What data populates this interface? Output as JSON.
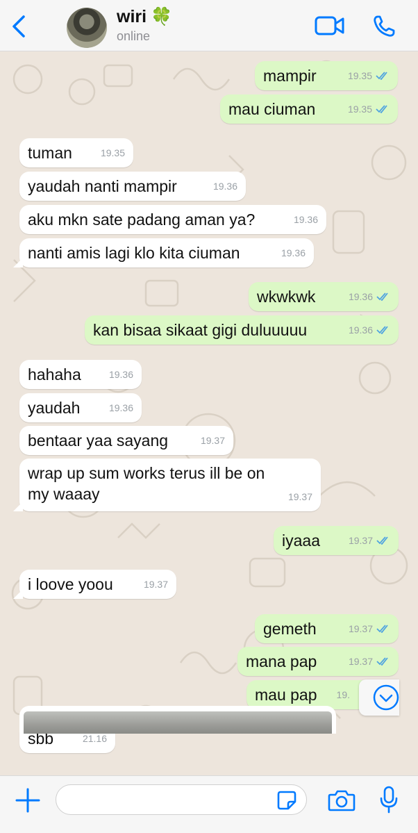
{
  "header": {
    "contact_name": "wiri",
    "name_emoji": "🍀",
    "status": "online",
    "icons": {
      "back": "chevron-left-icon",
      "video": "video-camera-icon",
      "call": "phone-icon"
    },
    "accent_color": "#007aff"
  },
  "messages": [
    {
      "dir": "out",
      "text": "mampir",
      "time": "19.35",
      "read": true
    },
    {
      "dir": "out",
      "text": "mau ciuman",
      "time": "19.35",
      "read": true
    },
    {
      "dir": "in",
      "text": "tuman",
      "time": "19.35"
    },
    {
      "dir": "in",
      "text": "yaudah nanti mampir",
      "time": "19.36"
    },
    {
      "dir": "in",
      "text": "aku mkn sate padang aman ya?",
      "time": "19.36"
    },
    {
      "dir": "in",
      "text": "nanti amis lagi klo kita ciuman",
      "time": "19.36"
    },
    {
      "dir": "out",
      "text": "wkwkwk",
      "time": "19.36",
      "read": true
    },
    {
      "dir": "out",
      "text": "kan bisaa sikaat gigi duluuuuu",
      "time": "19.36",
      "read": true
    },
    {
      "dir": "in",
      "text": "hahaha",
      "time": "19.36"
    },
    {
      "dir": "in",
      "text": "yaudah",
      "time": "19.36"
    },
    {
      "dir": "in",
      "text": "bentaar yaa sayang",
      "time": "19.37"
    },
    {
      "dir": "in",
      "text": "wrap up sum works terus ill be on my waaay",
      "time": "19.37"
    },
    {
      "dir": "out",
      "text": "iyaaa",
      "time": "19.37",
      "read": true
    },
    {
      "dir": "in",
      "text": "i loove yoou",
      "time": "19.37"
    },
    {
      "dir": "out",
      "text": "gemeth",
      "time": "19.37",
      "read": true
    },
    {
      "dir": "out",
      "text": "mana pap",
      "time": "19.37",
      "read": true
    },
    {
      "dir": "out",
      "text": "mau pap",
      "time": "19.",
      "read": true
    },
    {
      "dir": "in",
      "text": "sbb",
      "time": "21.16"
    }
  ],
  "colors": {
    "outgoing_bubble": "#dcf8c6",
    "incoming_bubble": "#ffffff",
    "read_ticks": "#4fa3e0",
    "chat_background": "#ede5dc"
  },
  "composer": {
    "placeholder": "",
    "icons": {
      "attach": "plus-icon",
      "sticker": "sticker-icon",
      "camera": "camera-icon",
      "mic": "microphone-icon",
      "scroll": "chevron-down-circle-icon"
    }
  }
}
